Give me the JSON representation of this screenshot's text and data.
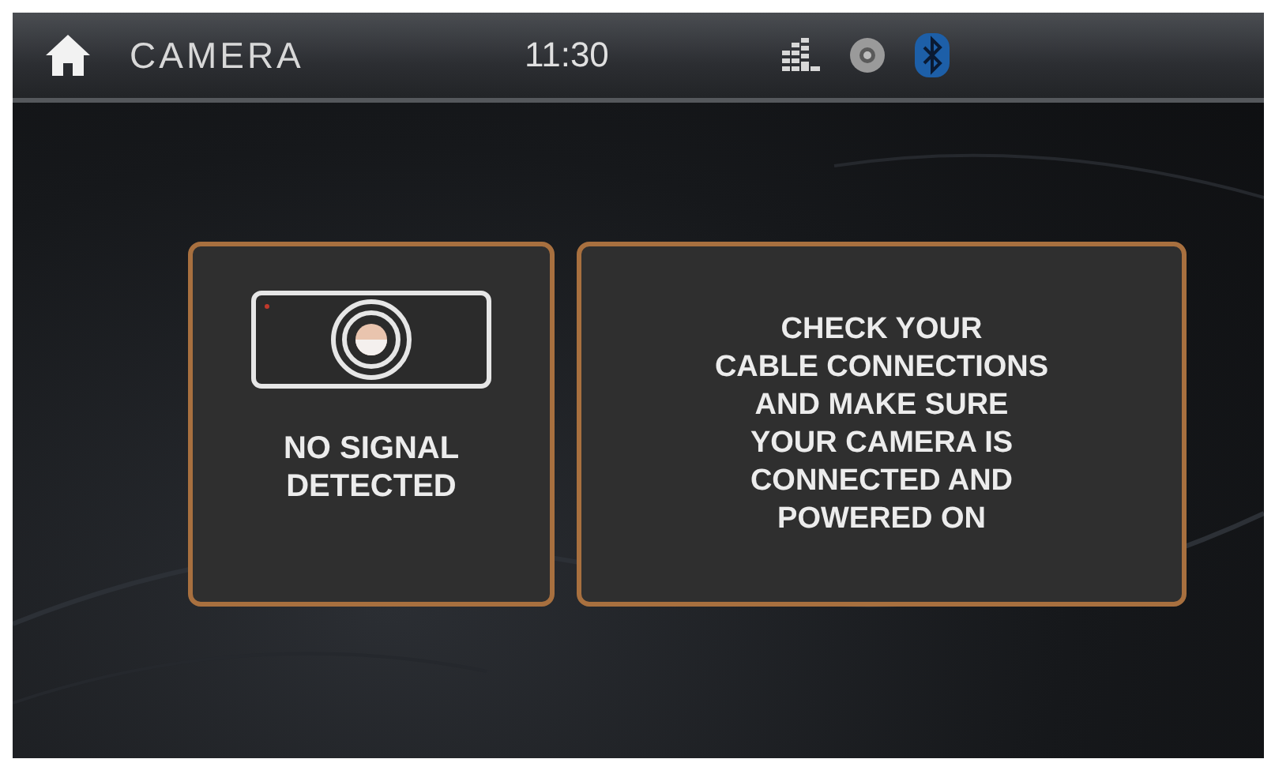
{
  "status_bar": {
    "title": "CAMERA",
    "time": "11:30",
    "bluetooth_connected": true
  },
  "signal_panel": {
    "message_lines": [
      "NO SIGNAL",
      "DETECTED"
    ]
  },
  "help_panel": {
    "message_lines": [
      "CHECK YOUR",
      "CABLE CONNECTIONS",
      "AND MAKE SURE",
      "YOUR CAMERA IS",
      "CONNECTED AND",
      "POWERED ON"
    ]
  }
}
